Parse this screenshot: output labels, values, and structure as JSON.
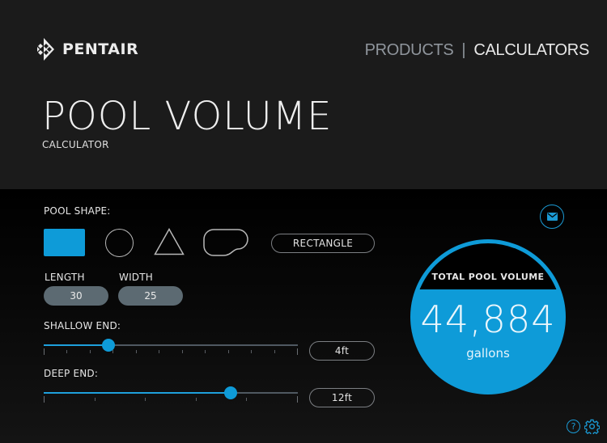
{
  "brand": {
    "name": "PENTAIR"
  },
  "nav": {
    "products": "PRODUCTS",
    "separator": "|",
    "calculators": "CALCULATORS"
  },
  "page": {
    "title": "POOL VOLUME",
    "subtitle": "CALCULATOR"
  },
  "colors": {
    "accent": "#0e9bd8",
    "header_bg": "#1b1b1b",
    "field_bg": "#5c6a72"
  },
  "pool_shape": {
    "label": "POOL SHAPE:",
    "options": [
      {
        "id": "rectangle",
        "icon": "rectangle-shape-icon",
        "selected": true
      },
      {
        "id": "circle",
        "icon": "circle-shape-icon",
        "selected": false
      },
      {
        "id": "triangle",
        "icon": "triangle-shape-icon",
        "selected": false
      },
      {
        "id": "kidney",
        "icon": "kidney-shape-icon",
        "selected": false
      }
    ],
    "selected_name": "RECTANGLE"
  },
  "dimensions": {
    "length": {
      "label": "LENGTH",
      "value": "30"
    },
    "width": {
      "label": "WIDTH",
      "value": "25"
    }
  },
  "shallow_end": {
    "label": "SHALLOW END:",
    "value": "4ft",
    "fraction": 0.255,
    "ticks": 12
  },
  "deep_end": {
    "label": "DEEP END:",
    "value": "12ft",
    "fraction": 0.736,
    "ticks": 6
  },
  "result": {
    "label": "TOTAL POOL VOLUME",
    "value": "44,884",
    "unit": "gallons"
  },
  "icons": {
    "email": "email-icon",
    "help": "help-icon",
    "settings": "gear-icon",
    "help_glyph": "?"
  }
}
